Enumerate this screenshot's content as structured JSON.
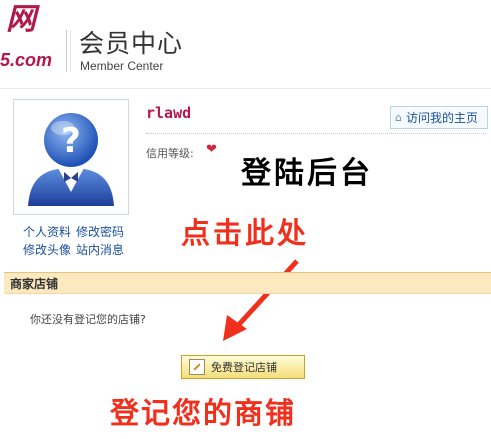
{
  "header": {
    "logo_mark": "网",
    "logo_domain": "5.com",
    "title_cn": "会员中心",
    "title_en": "Member Center"
  },
  "profile": {
    "username": "rlawd",
    "visit_homepage": "访问我的主页",
    "credit_level_label": "信用等级:",
    "links": [
      "个人资料",
      "修改密码",
      "修改头像",
      "站内消息"
    ]
  },
  "shop": {
    "section_title": "商家店铺",
    "question": "你还没有登记您的店铺?",
    "register_button": "免费登记店铺"
  },
  "annotations": {
    "login": "登陆后台",
    "click_here": "点击此处",
    "register_shop": "登记您的商铺"
  },
  "colors": {
    "brand": "#b3184a",
    "annotation_red": "#f0301c",
    "link_blue": "#1a4f9b",
    "section_bg": "#fde9c0"
  },
  "icons": {
    "avatar": "question-avatar-icon",
    "home": "house-icon",
    "credit": "heart-icon",
    "register": "pen-paper-icon"
  }
}
